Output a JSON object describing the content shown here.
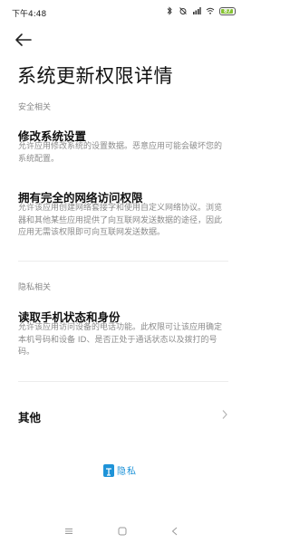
{
  "status_bar": {
    "time": "下午4:48",
    "battery_level": "87",
    "accent": "#86c232"
  },
  "header": {
    "back_icon": "arrow-left-icon",
    "title": "系统更新权限详情"
  },
  "sections": [
    {
      "header": "安全相关",
      "items": [
        {
          "title": "修改系统设置",
          "desc": "允许应用修改系统的设置数据。恶意应用可能会破坏您的系统配置。"
        },
        {
          "title": "拥有完全的网络访问权限",
          "desc": "允许该应用创建网络套接字和使用自定义网络协议。浏览器和其他某些应用提供了向互联网发送数据的途径，因此应用无需该权限即可向互联网发送数据。"
        }
      ]
    },
    {
      "header": "隐私相关",
      "items": [
        {
          "title": "读取手机状态和身份",
          "desc": "允许该应用访问设备的电话功能。此权限可让该应用确定本机号码和设备 ID、是否正处于通话状态以及拨打的号码。"
        }
      ]
    }
  ],
  "other": {
    "label": "其他",
    "chevron_icon": "chevron-right-icon"
  },
  "badge": {
    "text": "隐私",
    "color": "#1e93d8"
  },
  "nav_bar": {
    "menu_icon": "menu-icon",
    "home_icon": "home-icon",
    "back_icon": "back-triangle-icon"
  }
}
